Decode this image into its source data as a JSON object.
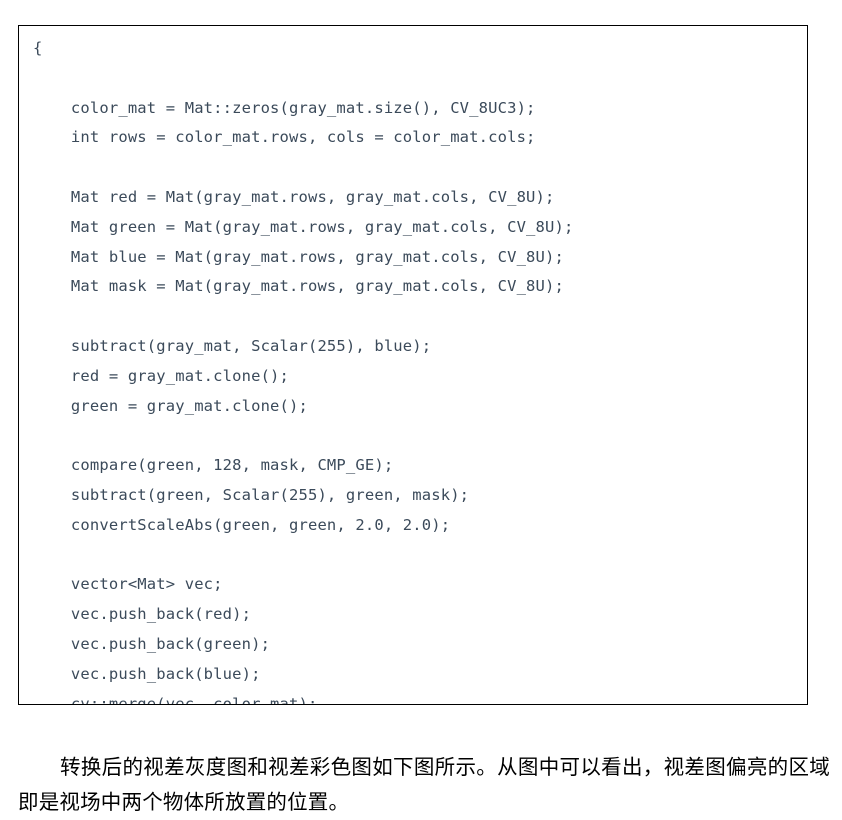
{
  "document": {
    "code_block": {
      "language": "cpp",
      "border_color": "#000000",
      "text_color": "#3b4a5a",
      "background_color": "#ffffff",
      "lines": [
        "{",
        "",
        "    color_mat = Mat::zeros(gray_mat.size(), CV_8UC3);",
        "    int rows = color_mat.rows, cols = color_mat.cols;",
        "",
        "    Mat red = Mat(gray_mat.rows, gray_mat.cols, CV_8U);",
        "    Mat green = Mat(gray_mat.rows, gray_mat.cols, CV_8U);",
        "    Mat blue = Mat(gray_mat.rows, gray_mat.cols, CV_8U);",
        "    Mat mask = Mat(gray_mat.rows, gray_mat.cols, CV_8U);",
        "",
        "    subtract(gray_mat, Scalar(255), blue);",
        "    red = gray_mat.clone();",
        "    green = gray_mat.clone();",
        "",
        "    compare(green, 128, mask, CMP_GE);",
        "    subtract(green, Scalar(255), green, mask);",
        "    convertScaleAbs(green, green, 2.0, 2.0);",
        "",
        "    vector<Mat> vec;",
        "    vec.push_back(red);",
        "    vec.push_back(green);",
        "    vec.push_back(blue);",
        "    cv::merge(vec, color_mat);",
        "",
        "}"
      ]
    },
    "paragraph": {
      "text": "转换后的视差灰度图和视差彩色图如下图所示。从图中可以看出，视差图偏亮的区域即是视场中两个物体所放置的位置。"
    }
  }
}
